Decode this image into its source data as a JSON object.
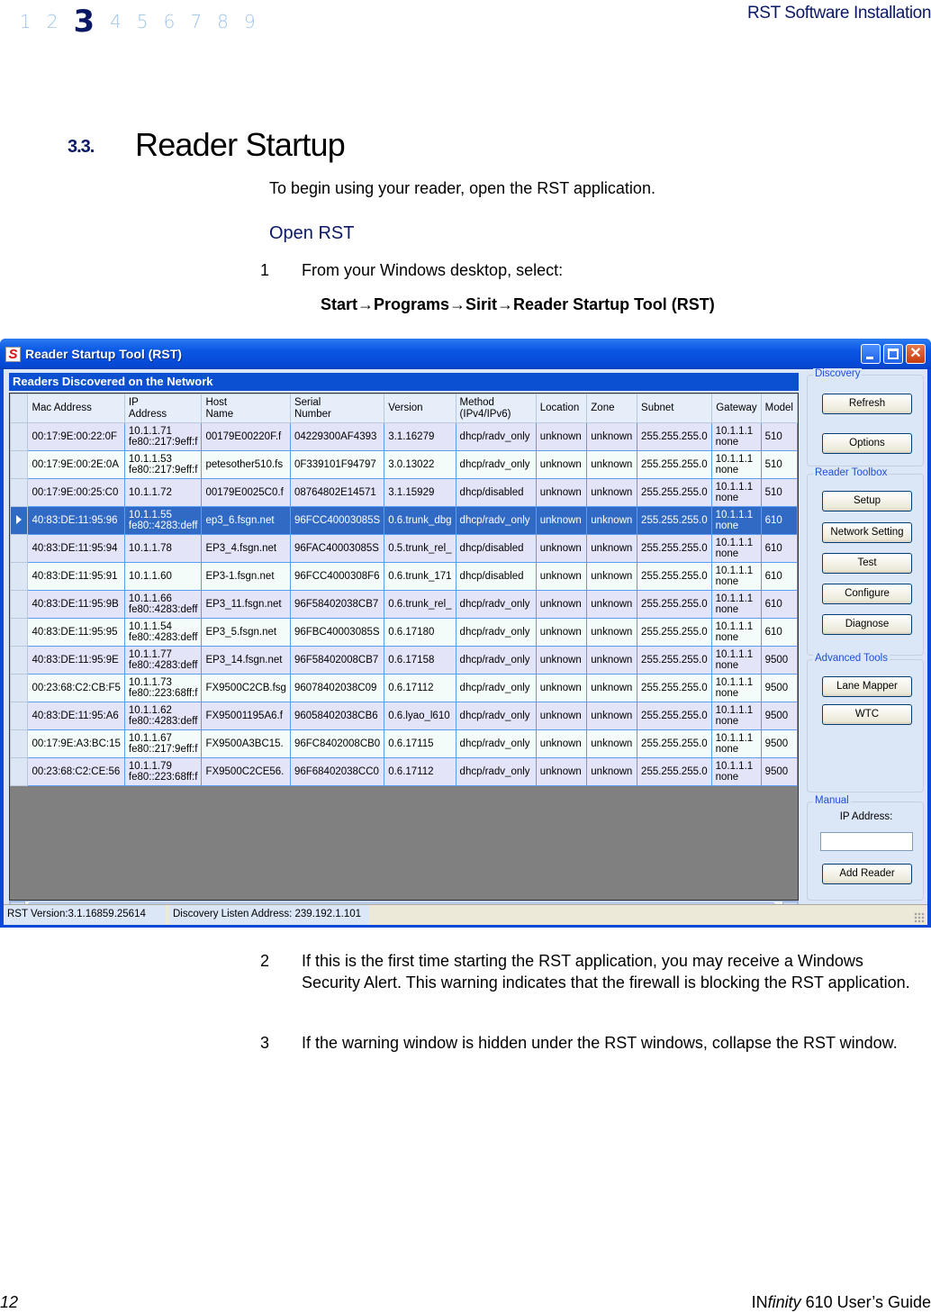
{
  "header": {
    "chapters": [
      "1",
      "2",
      "3",
      "4",
      "5",
      "6",
      "7",
      "8",
      "9"
    ],
    "active_chapter": "3",
    "running_head": "RST Software Installation"
  },
  "section": {
    "number": "3.3.",
    "title": "Reader Startup",
    "intro": "To begin using your reader, open the RST application.",
    "subhead": "Open RST",
    "steps": [
      {
        "num": "1",
        "text": "From your Windows desktop, select:"
      },
      {
        "num": "2",
        "text": "If this is the first time starting the RST application, you may receive a Windows Security Alert. This warning indicates that the firewall is blocking the RST application."
      },
      {
        "num": "3",
        "text": "If the warning window is hidden under the RST windows, collapse the RST window."
      }
    ],
    "menu_path": "Start→Programs→Sirit→Reader Startup Tool (RST)"
  },
  "window": {
    "logo": "S",
    "title": "Reader Startup Tool (RST)",
    "close_glyph": "✕",
    "grid_caption": "Readers Discovered on the Network",
    "columns": [
      [
        "Mac Address",
        ""
      ],
      [
        "IP",
        "Address"
      ],
      [
        "Host",
        "Name"
      ],
      [
        "Serial",
        "Number"
      ],
      [
        "Version",
        ""
      ],
      [
        "Method",
        "(IPv4/IPv6)"
      ],
      [
        "Location",
        ""
      ],
      [
        "Zone",
        ""
      ],
      [
        "Subnet",
        ""
      ],
      [
        "Gateway",
        ""
      ],
      [
        "Model",
        ""
      ]
    ],
    "selected_row": 3,
    "rows": [
      {
        "mac": "00:17:9E:00:22:0F",
        "ip": [
          "10.1.1.71",
          "fe80::217:9eff:f"
        ],
        "host": "00179E00220F.f",
        "serial": "04229300AF4393",
        "version": "3.1.16279",
        "method": "dhcp/radv_only",
        "location": "unknown",
        "zone": "unknown",
        "subnet": "255.255.255.0",
        "gateway": [
          "10.1.1.1",
          "none"
        ],
        "model": "510"
      },
      {
        "mac": "00:17:9E:00:2E:0A",
        "ip": [
          "10.1.1.53",
          "fe80::217:9eff:f"
        ],
        "host": "petesother510.fs",
        "serial": "0F339101F94797",
        "version": "3.0.13022",
        "method": "dhcp/radv_only",
        "location": "unknown",
        "zone": "unknown",
        "subnet": "255.255.255.0",
        "gateway": [
          "10.1.1.1",
          "none"
        ],
        "model": "510"
      },
      {
        "mac": "00:17:9E:00:25:C0",
        "ip": [
          "10.1.1.72",
          ""
        ],
        "host": "00179E0025C0.f",
        "serial": "08764802E14571",
        "version": "3.1.15929",
        "method": "dhcp/disabled",
        "location": "unknown",
        "zone": "unknown",
        "subnet": "255.255.255.0",
        "gateway": [
          "10.1.1.1",
          "none"
        ],
        "model": "510"
      },
      {
        "mac": "40:83:DE:11:95:96",
        "ip": [
          "10.1.1.55",
          "fe80::4283:deff"
        ],
        "host": "ep3_6.fsgn.net",
        "serial": "96FCC40003085S",
        "version": "0.6.trunk_dbg",
        "method": "dhcp/radv_only",
        "location": "unknown",
        "zone": "unknown",
        "subnet": "255.255.255.0",
        "gateway": [
          "10.1.1.1",
          "none"
        ],
        "model": "610"
      },
      {
        "mac": "40:83:DE:11:95:94",
        "ip": [
          "10.1.1.78",
          ""
        ],
        "host": "EP3_4.fsgn.net",
        "serial": "96FAC40003085S",
        "version": "0.5.trunk_rel_",
        "method": "dhcp/disabled",
        "location": "unknown",
        "zone": "unknown",
        "subnet": "255.255.255.0",
        "gateway": [
          "10.1.1.1",
          "none"
        ],
        "model": "610"
      },
      {
        "mac": "40:83:DE:11:95:91",
        "ip": [
          "10.1.1.60",
          ""
        ],
        "host": "EP3-1.fsgn.net",
        "serial": "96FCC4000308F6",
        "version": "0.6.trunk_171",
        "method": "dhcp/disabled",
        "location": "unknown",
        "zone": "unknown",
        "subnet": "255.255.255.0",
        "gateway": [
          "10.1.1.1",
          "none"
        ],
        "model": "610"
      },
      {
        "mac": "40:83:DE:11:95:9B",
        "ip": [
          "10.1.1.66",
          "fe80::4283:deff"
        ],
        "host": "EP3_11.fsgn.net",
        "serial": "96F58402038CB7",
        "version": "0.6.trunk_rel_",
        "method": "dhcp/radv_only",
        "location": "unknown",
        "zone": "unknown",
        "subnet": "255.255.255.0",
        "gateway": [
          "10.1.1.1",
          "none"
        ],
        "model": "610"
      },
      {
        "mac": "40:83:DE:11:95:95",
        "ip": [
          "10.1.1.54",
          "fe80::4283:deff"
        ],
        "host": "EP3_5.fsgn.net",
        "serial": "96FBC40003085S",
        "version": "0.6.17180",
        "method": "dhcp/radv_only",
        "location": "unknown",
        "zone": "unknown",
        "subnet": "255.255.255.0",
        "gateway": [
          "10.1.1.1",
          "none"
        ],
        "model": "610"
      },
      {
        "mac": "40:83:DE:11:95:9E",
        "ip": [
          "10.1.1.77",
          "fe80::4283:deff"
        ],
        "host": "EP3_14.fsgn.net",
        "serial": "96F58402008CB7",
        "version": "0.6.17158",
        "method": "dhcp/radv_only",
        "location": "unknown",
        "zone": "unknown",
        "subnet": "255.255.255.0",
        "gateway": [
          "10.1.1.1",
          "none"
        ],
        "model": "9500"
      },
      {
        "mac": "00:23:68:C2:CB:F5",
        "ip": [
          "10.1.1.73",
          "fe80::223:68ff:f"
        ],
        "host": "FX9500C2CB.fsg",
        "serial": "96078402038C09",
        "version": "0.6.17112",
        "method": "dhcp/radv_only",
        "location": "unknown",
        "zone": "unknown",
        "subnet": "255.255.255.0",
        "gateway": [
          "10.1.1.1",
          "none"
        ],
        "model": "9500"
      },
      {
        "mac": "40:83:DE:11:95:A6",
        "ip": [
          "10.1.1.62",
          "fe80::4283:deff"
        ],
        "host": "FX95001195A6.f",
        "serial": "96058402038CB6",
        "version": "0.6.lyao_l610",
        "method": "dhcp/radv_only",
        "location": "unknown",
        "zone": "unknown",
        "subnet": "255.255.255.0",
        "gateway": [
          "10.1.1.1",
          "none"
        ],
        "model": "9500"
      },
      {
        "mac": "00:17:9E:A3:BC:15",
        "ip": [
          "10.1.1.67",
          "fe80::217:9eff:f"
        ],
        "host": "FX9500A3BC15.",
        "serial": "96FC8402008CB0",
        "version": "0.6.17115",
        "method": "dhcp/radv_only",
        "location": "unknown",
        "zone": "unknown",
        "subnet": "255.255.255.0",
        "gateway": [
          "10.1.1.1",
          "none"
        ],
        "model": "9500"
      },
      {
        "mac": "00:23:68:C2:CE:56",
        "ip": [
          "10.1.1.79",
          "fe80::223:68ff:f"
        ],
        "host": "FX9500C2CE56.",
        "serial": "96F68402038CC0",
        "version": "0.6.17112",
        "method": "dhcp/radv_only",
        "location": "unknown",
        "zone": "unknown",
        "subnet": "255.255.255.0",
        "gateway": [
          "10.1.1.1",
          "none"
        ],
        "model": "9500"
      }
    ],
    "panel": {
      "discovery": {
        "legend": "Discovery",
        "refresh": "Refresh",
        "options": "Options"
      },
      "toolbox": {
        "legend": "Reader Toolbox",
        "setup": "Setup",
        "network": "Network Setting",
        "test": "Test",
        "configure": "Configure",
        "diagnose": "Diagnose"
      },
      "advanced": {
        "legend": "Advanced Tools",
        "lane_mapper": "Lane Mapper",
        "wtc": "WTC"
      },
      "manual": {
        "legend": "Manual",
        "ip_label": "IP Address:",
        "ip_value": "",
        "add_reader": "Add Reader"
      }
    },
    "status": {
      "version": "RST Version:3.1.16859.25614",
      "listen": "Discovery Listen Address: 239.192.1.101"
    }
  },
  "footer": {
    "page_number": "12",
    "brand_prefix": "IN",
    "brand_italic": "finity",
    "guide_suffix": " 610 User’s Guide"
  }
}
